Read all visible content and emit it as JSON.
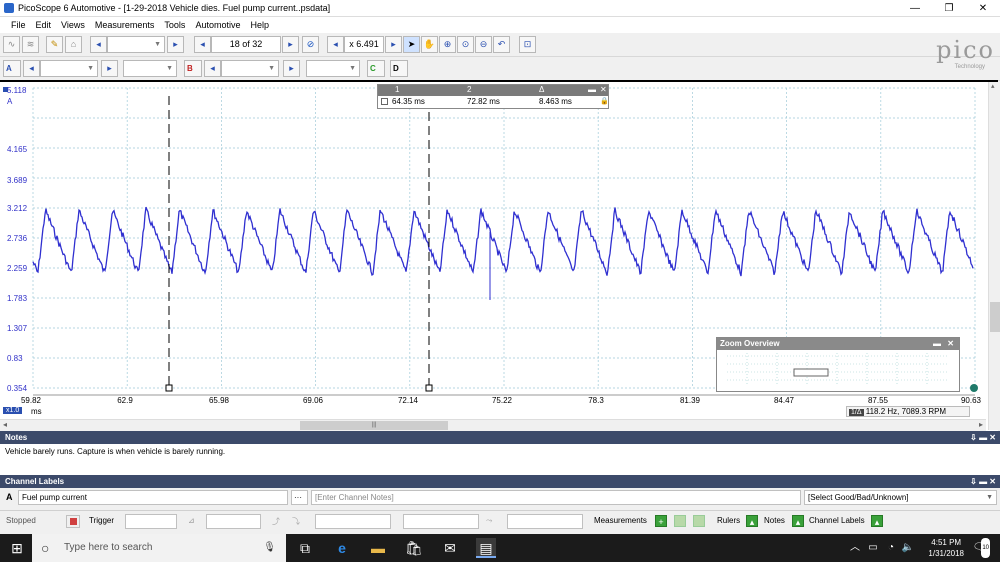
{
  "window": {
    "title": "PicoScope 6 Automotive - [1-29-2018 Vehicle dies.  Fuel pump current..psdata]",
    "minimize": "—",
    "restore": "❐",
    "close": "✕"
  },
  "menu": [
    "File",
    "Edit",
    "Views",
    "Measurements",
    "Tools",
    "Automotive",
    "Help"
  ],
  "toolbar1": {
    "buffer_label": "18 of 32",
    "zoom_label": "x 6.491"
  },
  "toolbar2": {
    "channels": [
      "A",
      "B",
      "C",
      "D"
    ]
  },
  "logo": {
    "main": "pico",
    "sub": "Technology"
  },
  "scope": {
    "y_labels": [
      "5.118",
      "A",
      "4.165",
      "3.689",
      "3.212",
      "2.736",
      "2.259",
      "1.783",
      "1.307",
      "0.83",
      "0.354"
    ],
    "x_labels": [
      "59.82",
      "62.9",
      "65.98",
      "69.06",
      "72.14",
      "75.22",
      "78.3",
      "81.39",
      "84.47",
      "87.55",
      "90.63"
    ],
    "x_unit_badge": "x1.0",
    "x_unit": "ms",
    "trace_color": "#2f2fd0",
    "freq_readout": "118.2 Hz, 7089.3 RPM",
    "freq_badge": "1/Δ"
  },
  "rulers": {
    "headers": [
      "1",
      "2",
      "Δ"
    ],
    "values": [
      "64.35 ms",
      "72.82 ms",
      "8.463 ms"
    ]
  },
  "zoom_overview": {
    "title": "Zoom Overview"
  },
  "notes": {
    "header": "Notes",
    "text": "Vehicle barely runs. Capture is when vehicle is barely running."
  },
  "channel_labels": {
    "header": "Channel Labels",
    "channel": "A",
    "name": "Fuel pump current",
    "notes_placeholder": "[Enter Channel Notes]",
    "rating": "[Select Good/Bad/Unknown]"
  },
  "bottombar": {
    "stopped": "Stopped",
    "trigger": "Trigger",
    "measurements": "Measurements",
    "rulers": "Rulers",
    "notes": "Notes",
    "channel_labels": "Channel Labels"
  },
  "taskbar": {
    "search_placeholder": "Type here to search",
    "time": "4:51 PM",
    "date": "1/31/2018",
    "notif_count": "10"
  }
}
